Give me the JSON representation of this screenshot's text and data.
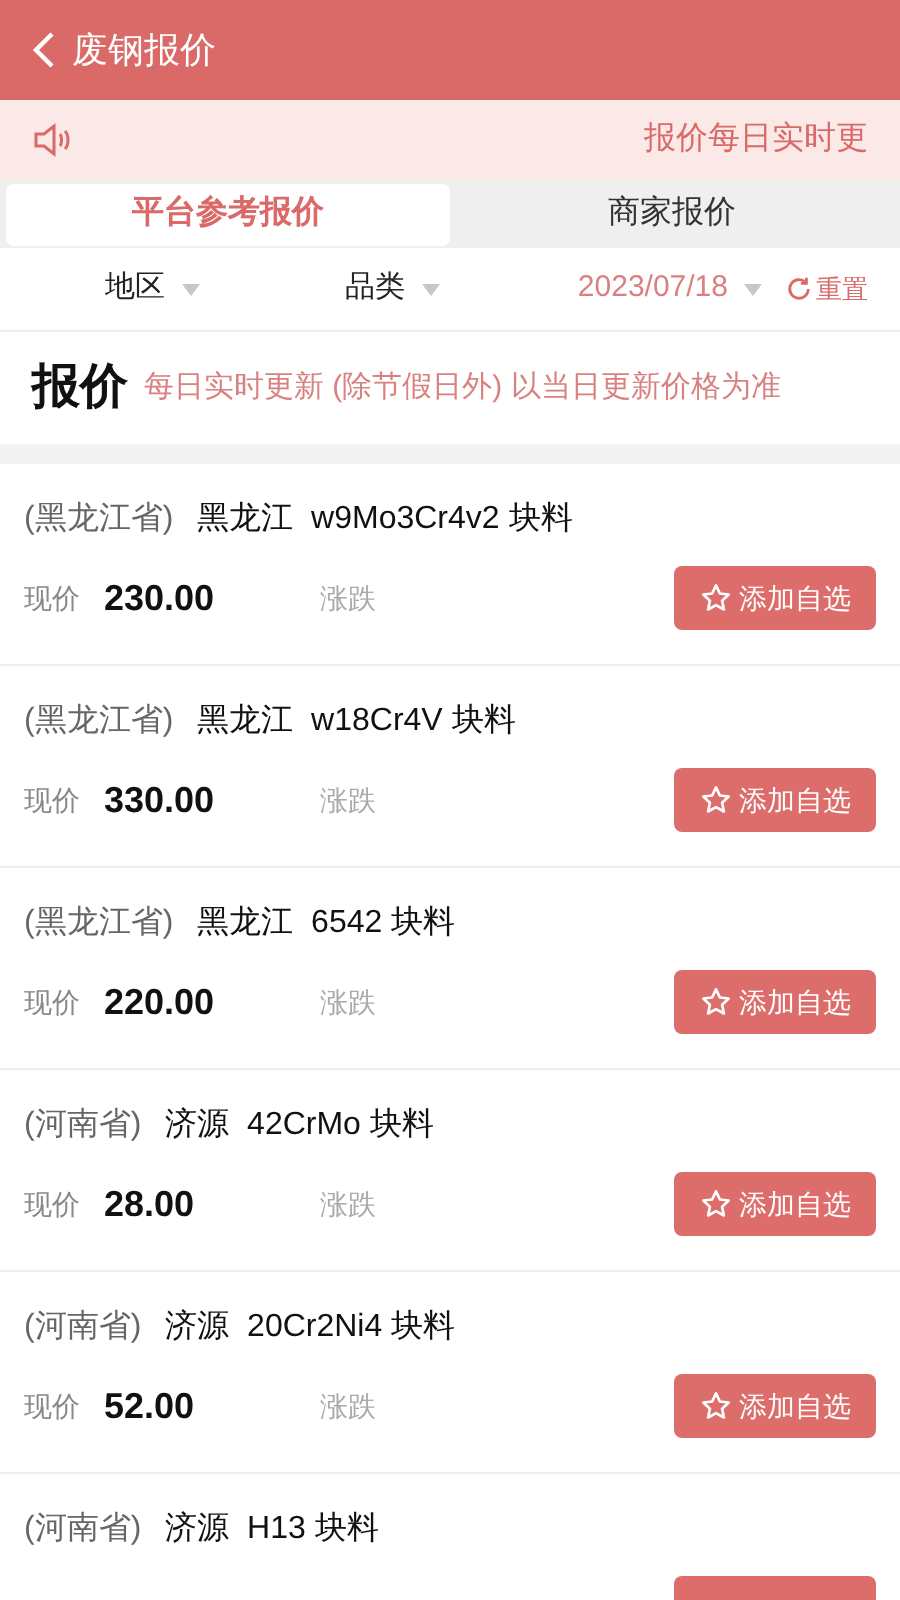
{
  "header": {
    "title": "废钢报价"
  },
  "notice": {
    "text": "报价每日实时更"
  },
  "tabs": [
    {
      "label": "平台参考报价",
      "selected": true
    },
    {
      "label": "商家报价",
      "selected": false
    }
  ],
  "filters": [
    {
      "kind": "dropdown",
      "label": "地区"
    },
    {
      "kind": "dropdown",
      "label": "品类"
    },
    {
      "kind": "date",
      "label": "2023/07/18"
    },
    {
      "kind": "reset",
      "label": "重置"
    }
  ],
  "banner": {
    "title": "报价",
    "text": "每日实时更新 (除节假日外) 以当日更新价格为准"
  },
  "items": [
    {
      "province": "(黑龙江省)",
      "city": "黑龙江",
      "product": "w9Mo3Cr4v2 块料",
      "price_label": "现价",
      "price": "230.00",
      "change_label": "涨跌",
      "button": "添加自选"
    },
    {
      "province": "(黑龙江省)",
      "city": "黑龙江",
      "product": "w18Cr4V 块料",
      "price_label": "现价",
      "price": "330.00",
      "change_label": "涨跌",
      "button": "添加自选"
    },
    {
      "province": "(黑龙江省)",
      "city": "黑龙江",
      "product": "6542 块料",
      "price_label": "现价",
      "price": "220.00",
      "change_label": "涨跌",
      "button": "添加自选"
    },
    {
      "province": "(河南省)",
      "city": "济源",
      "product": "42CrMo 块料",
      "price_label": "现价",
      "price": "28.00",
      "change_label": "涨跌",
      "button": "添加自选"
    },
    {
      "province": "(河南省)",
      "city": "济源",
      "product": "20Cr2Ni4 块料",
      "price_label": "现价",
      "price": "52.00",
      "change_label": "涨跌",
      "button": "添加自选"
    },
    {
      "province": "(河南省)",
      "city": "济源",
      "product": "H13 块料"
    }
  ]
}
